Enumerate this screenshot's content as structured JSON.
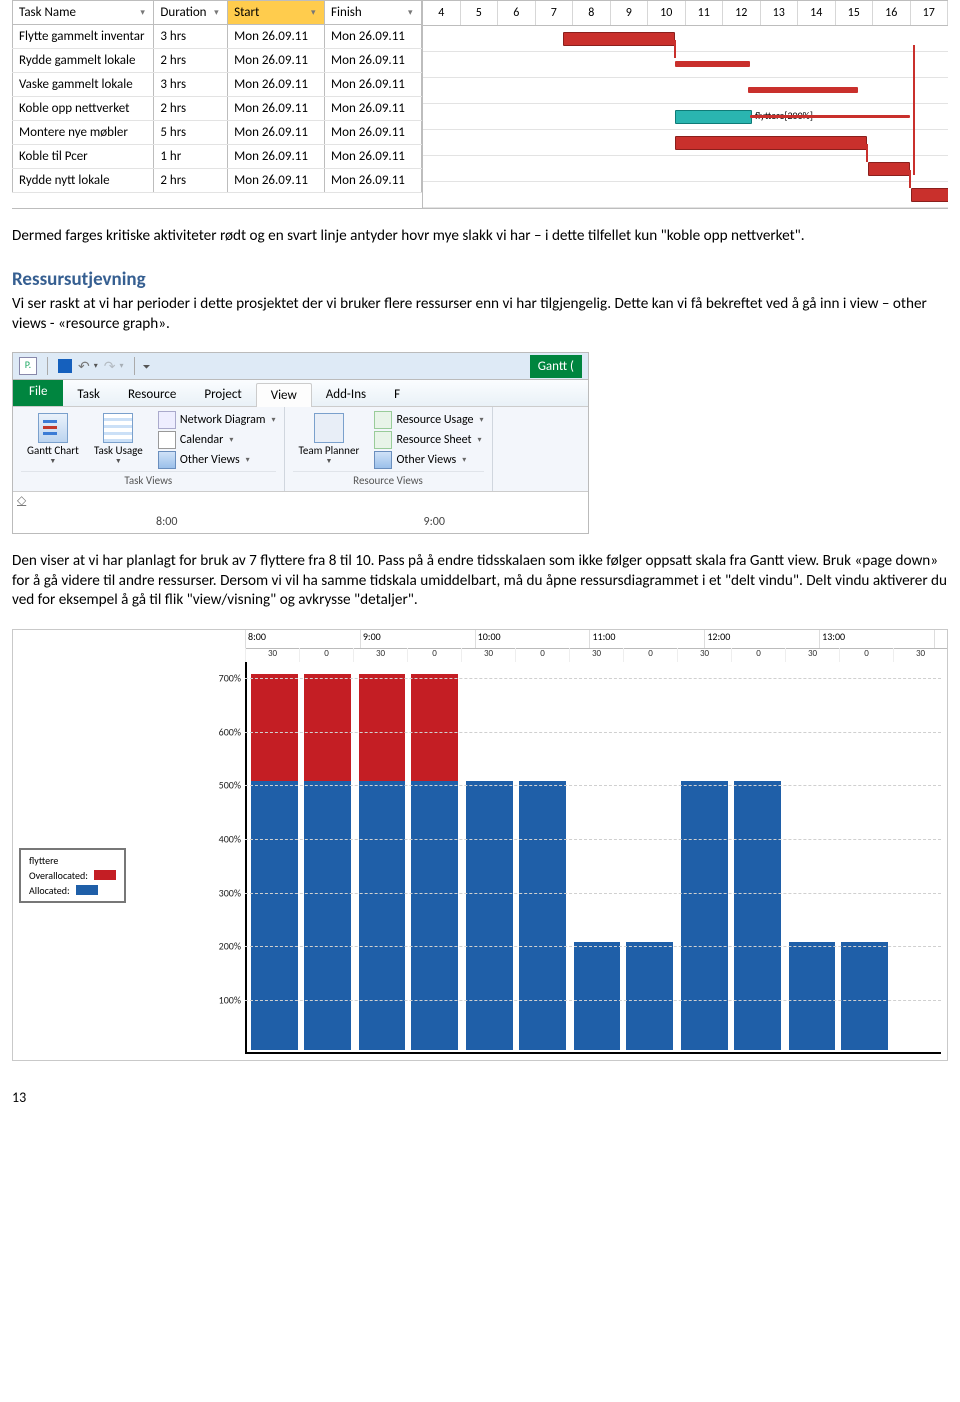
{
  "gantt": {
    "cols": {
      "task": "Task Name",
      "duration": "Duration",
      "start": "Start",
      "finish": "Finish"
    },
    "timeline": [
      "4",
      "5",
      "6",
      "7",
      "8",
      "9",
      "10",
      "11",
      "12",
      "13",
      "14",
      "15",
      "16",
      "17"
    ],
    "rows": [
      {
        "name": "Flytte gammelt inventar",
        "dur": "3 hrs",
        "start": "Mon 26.09.11",
        "finish": "Mon 26.09.11"
      },
      {
        "name": "Rydde gammelt lokale",
        "dur": "2 hrs",
        "start": "Mon 26.09.11",
        "finish": "Mon 26.09.11"
      },
      {
        "name": "Vaske gammelt lokale",
        "dur": "3 hrs",
        "start": "Mon 26.09.11",
        "finish": "Mon 26.09.11"
      },
      {
        "name": "Koble opp nettverket",
        "dur": "2 hrs",
        "start": "Mon 26.09.11",
        "finish": "Mon 26.09.11"
      },
      {
        "name": "Montere nye møbler",
        "dur": "5 hrs",
        "start": "Mon 26.09.11",
        "finish": "Mon 26.09.11"
      },
      {
        "name": "Koble til Pcer",
        "dur": "1 hr",
        "start": "Mon 26.09.11",
        "finish": "Mon 26.09.11"
      },
      {
        "name": "Rydde nytt lokale",
        "dur": "2 hrs",
        "start": "Mon 26.09.11",
        "finish": "Mon 26.09.11"
      }
    ],
    "bar_label": "flyttere[200%]"
  },
  "p1": "Dermed farges kritiske aktiviteter rødt og en svart linje antyder hovr mye slakk vi har – i dette tilfellet kun \"koble opp nettverket\".",
  "h_ressurs": "Ressursutjevning",
  "p2": "Vi ser raskt at vi har perioder i dette prosjektet der vi bruker flere ressurser enn vi har tilgjengelig. Dette kan vi få bekreftet ved å gå inn i view – other views - «resource graph».",
  "ribbon": {
    "qat_right": "Gantt (",
    "file": "File",
    "tabs": [
      "Task",
      "Resource",
      "Project",
      "View",
      "Add-Ins",
      "F"
    ],
    "g1": {
      "gantt": "Gantt\nChart",
      "taskusage": "Task\nUsage",
      "net": "Network Diagram",
      "cal": "Calendar",
      "other": "Other Views",
      "label": "Task Views"
    },
    "g2": {
      "team": "Team\nPlanner",
      "ru": "Resource Usage",
      "rs": "Resource Sheet",
      "other": "Other Views",
      "label": "Resource Views"
    },
    "time": [
      "8:00",
      "9:00"
    ]
  },
  "p3": "Den viser at vi har planlagt for bruk av 7 flyttere fra 8 til 10. Pass på å endre tidsskalaen som ikke følger oppsatt skala fra Gantt view. Bruk «page down» for å gå videre til andre ressurser. Dersom vi vil ha samme tidskala umiddelbart, må du åpne ressursdiagrammet i et \"delt vindu\". Delt vindu aktiverer du ved for eksempel å gå til flik \"view/visning\" og avkrysse \"detaljer\".",
  "chart_data": {
    "type": "bar",
    "title": "",
    "resource": "flyttere",
    "legend": {
      "over": "Overallocated:",
      "alloc": "Allocated:"
    },
    "x_hours": [
      "8:00",
      "9:00",
      "10:00",
      "11:00",
      "12:00",
      "13:00"
    ],
    "x_sub": [
      "30",
      "0",
      "30",
      "0",
      "30",
      "0",
      "30",
      "0",
      "30",
      "0",
      "30",
      "0",
      "30"
    ],
    "ylabels": [
      "100%",
      "200%",
      "300%",
      "400%",
      "500%",
      "600%",
      "700%"
    ],
    "ylim": [
      0,
      730
    ],
    "slots": [
      {
        "over": 200,
        "alloc": 500
      },
      {
        "over": 200,
        "alloc": 500
      },
      {
        "over": 200,
        "alloc": 500
      },
      {
        "over": 200,
        "alloc": 500
      },
      {
        "over": 0,
        "alloc": 500
      },
      {
        "over": 0,
        "alloc": 500
      },
      {
        "over": 0,
        "alloc": 200
      },
      {
        "over": 0,
        "alloc": 200
      },
      {
        "over": 0,
        "alloc": 500
      },
      {
        "over": 0,
        "alloc": 500
      },
      {
        "over": 0,
        "alloc": 200
      },
      {
        "over": 0,
        "alloc": 200
      }
    ]
  },
  "page": "13"
}
